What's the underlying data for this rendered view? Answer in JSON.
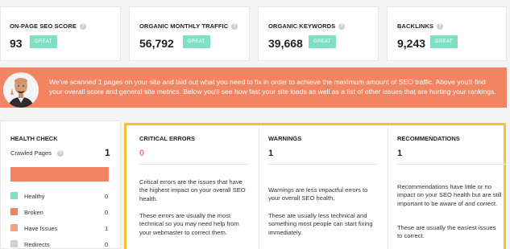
{
  "metrics": [
    {
      "label": "ON-PAGE SEO SCORE",
      "value": "93",
      "badge": "GREAT"
    },
    {
      "label": "ORGANIC MONTHLY TRAFFIC",
      "value": "56,792",
      "badge": "GREAT"
    },
    {
      "label": "ORGANIC KEYWORDS",
      "value": "39,668",
      "badge": "GREAT"
    },
    {
      "label": "BACKLINKS",
      "value": "9,243",
      "badge": "GREAT"
    }
  ],
  "help_glyph": "?",
  "banner": {
    "text": "We've scanned 1 pages on your site and laid out what you need to fix in order to achieve the maximum amount of SEO traffic. Above you'll find your overall score and general site metrics. Below you'll see how fast your site loads as well as a list of other issues that are hurting your rankings.",
    "color": "#f28462"
  },
  "health_check": {
    "title": "HEALTH CHECK",
    "crawled_label": "Crawled Pages",
    "crawled_value": "1",
    "legend": [
      {
        "label": "Healthy",
        "value": "0",
        "color": "#7fe0c4"
      },
      {
        "label": "Broken",
        "value": "0",
        "color": "#f28462"
      },
      {
        "label": "Have Issues",
        "value": "1",
        "color": "#f5a184"
      },
      {
        "label": "Redirects",
        "value": "0",
        "color": "#cfcfcf"
      }
    ]
  },
  "issues": {
    "critical": {
      "title": "CRITICAL ERRORS",
      "value": "0",
      "desc1": "Critical errors are the issues that have the highest impact on your overall SEO health.",
      "desc2": "These errors are usually the most technical so you may need help from your webmaster to correct them."
    },
    "warnings": {
      "title": "WARNINGS",
      "value": "1",
      "desc1": "Warnings are less impactful errors to your overall SEO health.",
      "desc2": "These are usually less technical and something most people can start fixing immediately."
    },
    "recommendations": {
      "title": "RECOMMENDATIONS",
      "value": "1",
      "desc1": "Recommendations have little or no impact on your SEO health but are still important to be aware of and correct.",
      "desc2": "These are usually the easiest issues to correct."
    }
  },
  "colors": {
    "accent_orange": "#f28462",
    "great_green": "#7fe0c4",
    "highlight_yellow": "#f3c234"
  }
}
